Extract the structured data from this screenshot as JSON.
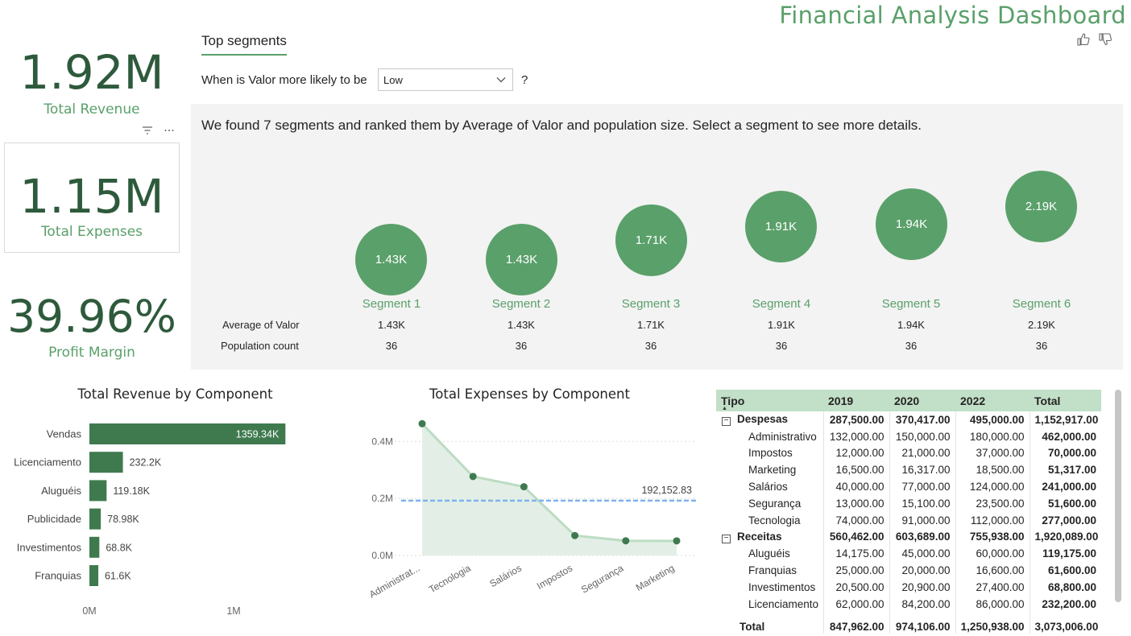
{
  "title": "Financial Analysis Dashboard",
  "kpis": {
    "revenue": {
      "value": "1.92M",
      "label": "Total Revenue"
    },
    "expenses": {
      "value": "1.15M",
      "label": "Total Expenses"
    },
    "margin": {
      "value": "39.96%",
      "label": "Profit Margin"
    }
  },
  "key_influencers": {
    "tab": "Top segments",
    "question": "When is Valor more likely to be",
    "selected_value": "Low",
    "help": "?",
    "summary": "We found 7 segments and ranked them by Average of Valor and population size. Select a segment to see more details.",
    "row_labels": [
      "Average of Valor",
      "Population count"
    ],
    "segments": [
      {
        "name": "Segment 1",
        "bubble": "1.43K",
        "avg": "1.43K",
        "count": "36"
      },
      {
        "name": "Segment 2",
        "bubble": "1.43K",
        "avg": "1.43K",
        "count": "36"
      },
      {
        "name": "Segment 3",
        "bubble": "1.71K",
        "avg": "1.71K",
        "count": "36"
      },
      {
        "name": "Segment 4",
        "bubble": "1.91K",
        "avg": "1.91K",
        "count": "36"
      },
      {
        "name": "Segment 5",
        "bubble": "1.94K",
        "avg": "1.94K",
        "count": "36"
      },
      {
        "name": "Segment 6",
        "bubble": "2.19K",
        "avg": "2.19K",
        "count": "36"
      }
    ]
  },
  "chart_data": [
    {
      "type": "bar",
      "orientation": "horizontal",
      "title": "Total Revenue by Component",
      "categories": [
        "Vendas",
        "Licenciamento",
        "Aluguéis",
        "Publicidade",
        "Investimentos",
        "Franquias"
      ],
      "values": [
        1359340,
        232200,
        119180,
        78980,
        68800,
        61600
      ],
      "data_labels": [
        "1359.34K",
        "232.2K",
        "119.18K",
        "78.98K",
        "68.8K",
        "61.6K"
      ],
      "x_ticks": [
        "0M",
        "1M"
      ],
      "xlim": [
        0,
        1000000
      ],
      "color": "#3f7a4f"
    },
    {
      "type": "area",
      "title": "Total Expenses by Component",
      "categories": [
        "Administrat...",
        "Tecnologia",
        "Salários",
        "Impostos",
        "Segurança",
        "Marketing"
      ],
      "values": [
        462000,
        277000,
        241000,
        70000,
        51600,
        51317
      ],
      "y_ticks": [
        "0.0M",
        "0.2M",
        "0.4M"
      ],
      "ylim": [
        0,
        460000
      ],
      "average_line": {
        "value": 192152.83,
        "label": "192,152.83"
      },
      "color": "#3f7a4f",
      "fill_color": "#e3efe6"
    }
  ],
  "matrix": {
    "headers": [
      "Tipo",
      "2019",
      "2020",
      "2022",
      "Total"
    ],
    "rows": [
      {
        "kind": "group",
        "expander": "⊟",
        "cells": [
          "Despesas",
          "287,500.00",
          "370,417.00",
          "495,000.00",
          "1,152,917.00"
        ]
      },
      {
        "kind": "item",
        "cells": [
          "Administrativo",
          "132,000.00",
          "150,000.00",
          "180,000.00",
          "462,000.00"
        ]
      },
      {
        "kind": "item",
        "cells": [
          "Impostos",
          "12,000.00",
          "21,000.00",
          "37,000.00",
          "70,000.00"
        ]
      },
      {
        "kind": "item",
        "cells": [
          "Marketing",
          "16,500.00",
          "16,317.00",
          "18,500.00",
          "51,317.00"
        ]
      },
      {
        "kind": "item",
        "cells": [
          "Salários",
          "40,000.00",
          "77,000.00",
          "124,000.00",
          "241,000.00"
        ]
      },
      {
        "kind": "item",
        "cells": [
          "Segurança",
          "13,000.00",
          "15,100.00",
          "23,500.00",
          "51,600.00"
        ]
      },
      {
        "kind": "item",
        "cells": [
          "Tecnologia",
          "74,000.00",
          "91,000.00",
          "112,000.00",
          "277,000.00"
        ]
      },
      {
        "kind": "group",
        "expander": "⊟",
        "cells": [
          "Receitas",
          "560,462.00",
          "603,689.00",
          "755,938.00",
          "1,920,089.00"
        ]
      },
      {
        "kind": "item",
        "cells": [
          "Aluguéis",
          "14,175.00",
          "45,000.00",
          "60,000.00",
          "119,175.00"
        ]
      },
      {
        "kind": "item",
        "cells": [
          "Franquias",
          "25,000.00",
          "20,000.00",
          "16,600.00",
          "61,600.00"
        ]
      },
      {
        "kind": "item",
        "cells": [
          "Investimentos",
          "20,500.00",
          "20,900.00",
          "27,400.00",
          "68,800.00"
        ]
      },
      {
        "kind": "item",
        "cells": [
          "Licenciamento",
          "62,000.00",
          "84,200.00",
          "86,000.00",
          "232,200.00"
        ]
      },
      {
        "kind": "total",
        "cells": [
          "Total",
          "847,962.00",
          "974,106.00",
          "1,250,938.00",
          "3,073,006.00"
        ]
      }
    ]
  },
  "icons": [
    "thumbs-up-icon",
    "thumbs-down-icon",
    "filter-icon",
    "more-options-icon",
    "chevron-down-icon",
    "sort-ascending-icon"
  ]
}
